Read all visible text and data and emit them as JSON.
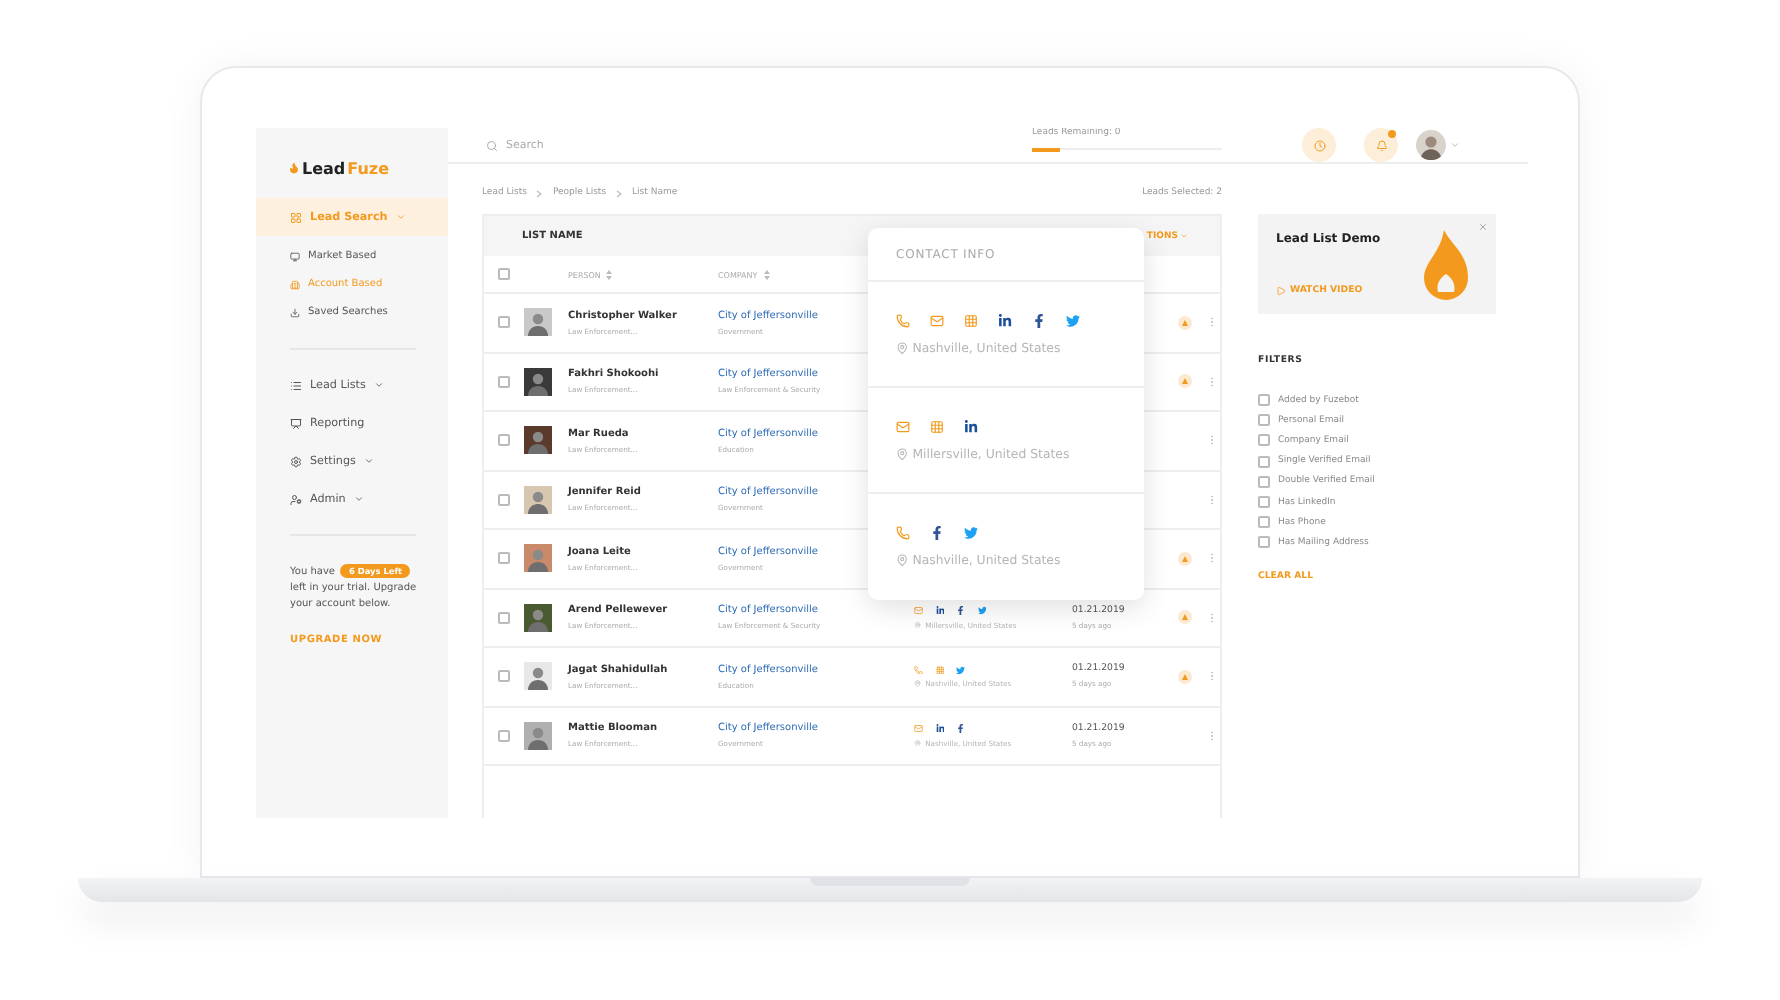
{
  "sidebar": {
    "logo": {
      "first": "Lead",
      "second": "Fuze"
    },
    "nav": [
      {
        "label": "Lead Search",
        "kind": "menu",
        "selected": true,
        "children": [
          {
            "label": "Market Based",
            "selected": false
          },
          {
            "label": "Account Based",
            "selected": true
          },
          {
            "label": "Saved Searches",
            "selected": false
          }
        ]
      },
      {
        "label": "Lead Lists",
        "kind": "menu",
        "selected": false
      },
      {
        "label": "Reporting",
        "kind": "link",
        "selected": false
      },
      {
        "label": "Settings",
        "kind": "menu",
        "selected": false
      },
      {
        "label": "Admin",
        "kind": "menu",
        "selected": false
      }
    ],
    "trial": {
      "before": "You have",
      "badge": "6 Days Left",
      "after": "left in your trial. Upgrade your account below.",
      "link": "UPGRADE NOW"
    }
  },
  "topbar": {
    "search": {
      "placeholder": "Search"
    },
    "leads_remaining": {
      "label": "Leads Remaining: 0",
      "level": 0.15
    },
    "notifications": {
      "unread": true
    }
  },
  "breadcrumb": [
    "Lead Lists",
    "People Lists",
    "List Name"
  ],
  "leads_selected": "Leads Selected: 2",
  "table": {
    "title": "LIST NAME",
    "actions": "TIONS",
    "all_checked": false,
    "columns": [
      "PERSON",
      "COMPANY"
    ],
    "rows": [
      {
        "name": "Christopher Walker",
        "title": "Law Enforcement...",
        "company": "City of Jeffersonville",
        "sector": "Government",
        "checked": false,
        "flagged": true
      },
      {
        "name": "Fakhri Shokoohi",
        "title": "Law Enforcement...",
        "company": "City of Jeffersonville",
        "sector": "Law Enforcement & Security",
        "checked": false,
        "flagged": true
      },
      {
        "name": "Mar Rueda",
        "title": "Law Enforcement...",
        "company": "City of Jeffersonville",
        "sector": "Education",
        "checked": false,
        "flagged": false
      },
      {
        "name": "Jennifer Reid",
        "title": "Law Enforcement...",
        "company": "City of Jeffersonville",
        "sector": "Government",
        "checked": false,
        "flagged": false
      },
      {
        "name": "Joana Leite",
        "title": "Law Enforcement...",
        "company": "City of Jeffersonville",
        "sector": "Government",
        "checked": false,
        "flagged": true
      },
      {
        "name": "Arend Pellewever",
        "title": "Law Enforcement...",
        "company": "City of Jeffersonville",
        "sector": "Law Enforcement & Security",
        "checked": false,
        "flagged": true,
        "contact": [
          {
            "kind": "email"
          },
          {
            "kind": "linkedin"
          },
          {
            "kind": "facebook"
          },
          {
            "kind": "twitter"
          }
        ],
        "location": "Millersville, United States",
        "date": "01.21.2019",
        "ago": "5 days ago"
      },
      {
        "name": "Jagat Shahidullah",
        "title": "Law Enforcement...",
        "company": "City of Jeffersonville",
        "sector": "Education",
        "checked": false,
        "flagged": true,
        "contact": [
          {
            "kind": "phone"
          },
          {
            "kind": "company"
          },
          {
            "kind": "twitter"
          }
        ],
        "location": "Nashville, United States",
        "date": "01.21.2019",
        "ago": "5 days ago"
      },
      {
        "name": "Mattie Blooman",
        "title": "Law Enforcement...",
        "company": "City of Jeffersonville",
        "sector": "Government",
        "checked": false,
        "flagged": false,
        "contact": [
          {
            "kind": "email"
          },
          {
            "kind": "linkedin"
          },
          {
            "kind": "facebook"
          }
        ],
        "location": "Nashville, United States",
        "date": "01.21.2019",
        "ago": "5 days ago"
      }
    ]
  },
  "contact_popup": {
    "title": "CONTACT INFO",
    "entries": [
      {
        "channels": [
          {
            "kind": "phone"
          },
          {
            "kind": "email"
          },
          {
            "kind": "company"
          },
          {
            "kind": "linkedin"
          },
          {
            "kind": "facebook"
          },
          {
            "kind": "twitter"
          }
        ],
        "location": "Nashville, United States"
      },
      {
        "channels": [
          {
            "kind": "email"
          },
          {
            "kind": "company"
          },
          {
            "kind": "linkedin"
          }
        ],
        "location": "Millersville, United States"
      },
      {
        "channels": [
          {
            "kind": "phone"
          },
          {
            "kind": "facebook"
          },
          {
            "kind": "twitter"
          }
        ],
        "location": "Nashville, United States"
      }
    ]
  },
  "demo_card": {
    "title": "Lead List Demo",
    "link": "WATCH VIDEO"
  },
  "filters": {
    "title": "FILTERS",
    "items": [
      {
        "label": "Added by Fuzebot",
        "checked": false
      },
      {
        "label": "Personal Email",
        "checked": false
      },
      {
        "label": "Company Email",
        "checked": false
      },
      {
        "label": "Single Verified Email",
        "checked": false
      },
      {
        "label": "Double Verified Email",
        "checked": false
      },
      {
        "label": "Has LinkedIn",
        "checked": false
      },
      {
        "label": "Has Phone",
        "checked": false
      },
      {
        "label": "Has Mailing Address",
        "checked": false
      }
    ],
    "clear": "CLEAR ALL"
  }
}
